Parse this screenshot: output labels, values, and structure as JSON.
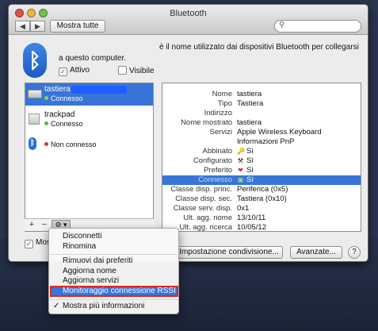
{
  "window": {
    "title": "Bluetooth",
    "show_all_label": "Mostra tutte"
  },
  "header": {
    "desc_line1": "è il nome utilizzato dai dispositivi Bluetooth per collegarsi",
    "desc_line2": "a questo computer.",
    "attivo_label": "Attivo",
    "visibile_label": "Visibile"
  },
  "devices": [
    {
      "name": "tastiera",
      "status": "Connesso",
      "status_color": "#7ed957"
    },
    {
      "name": "trackpad",
      "status": "Connesso",
      "status_color": "#58b848"
    },
    {
      "name": "",
      "status": "Non connesso",
      "status_color": "#d23b2e"
    }
  ],
  "bottom_bar": {
    "add": "+",
    "remove": "−",
    "gear": "⚙"
  },
  "info": [
    {
      "k": "Nome",
      "v": "tastiera",
      "icon": ""
    },
    {
      "k": "Tipo",
      "v": "Tastiera",
      "icon": ""
    },
    {
      "k": "Indirizzo",
      "v": "",
      "icon": ""
    },
    {
      "k": "Nome mostrato",
      "v": "tastiera",
      "icon": ""
    },
    {
      "k": "Servizi",
      "v": "Apple Wireless Keyboard",
      "icon": ""
    },
    {
      "k": "",
      "v": "Informazioni PnP",
      "icon": ""
    },
    {
      "k": "Abbinato",
      "v": "Sì",
      "icon": "🔑"
    },
    {
      "k": "Configurato",
      "v": "Sì",
      "icon": "⚒"
    },
    {
      "k": "Preferito",
      "v": "Sì",
      "icon": "❤"
    },
    {
      "k": "Connesso",
      "v": "Sì",
      "icon": "▣"
    },
    {
      "k": "Classe disp. princ.",
      "v": "Periferica (0x5)",
      "icon": ""
    },
    {
      "k": "Classe disp. sec.",
      "v": "Tastiera (0x10)",
      "icon": ""
    },
    {
      "k": "Classe serv. disp.",
      "v": "0x1",
      "icon": ""
    },
    {
      "k": "Ult. agg. nome",
      "v": "13/10/11",
      "icon": ""
    },
    {
      "k": "Ult. agg. ricerca",
      "v": "10/05/12",
      "icon": ""
    }
  ],
  "buttons": {
    "mostra_label": "Most",
    "share": "Impostazione condivisione...",
    "advanced": "Avanzate...",
    "help": "?"
  },
  "menu": {
    "items": [
      "Disconnetti",
      "Rinomina",
      "Rimuovi dai preferiti",
      "Aggiorna nome",
      "Aggiorna servizi",
      "Monitoraggio connessione RSSI",
      "Mostra più informazioni"
    ],
    "check": "✓"
  }
}
